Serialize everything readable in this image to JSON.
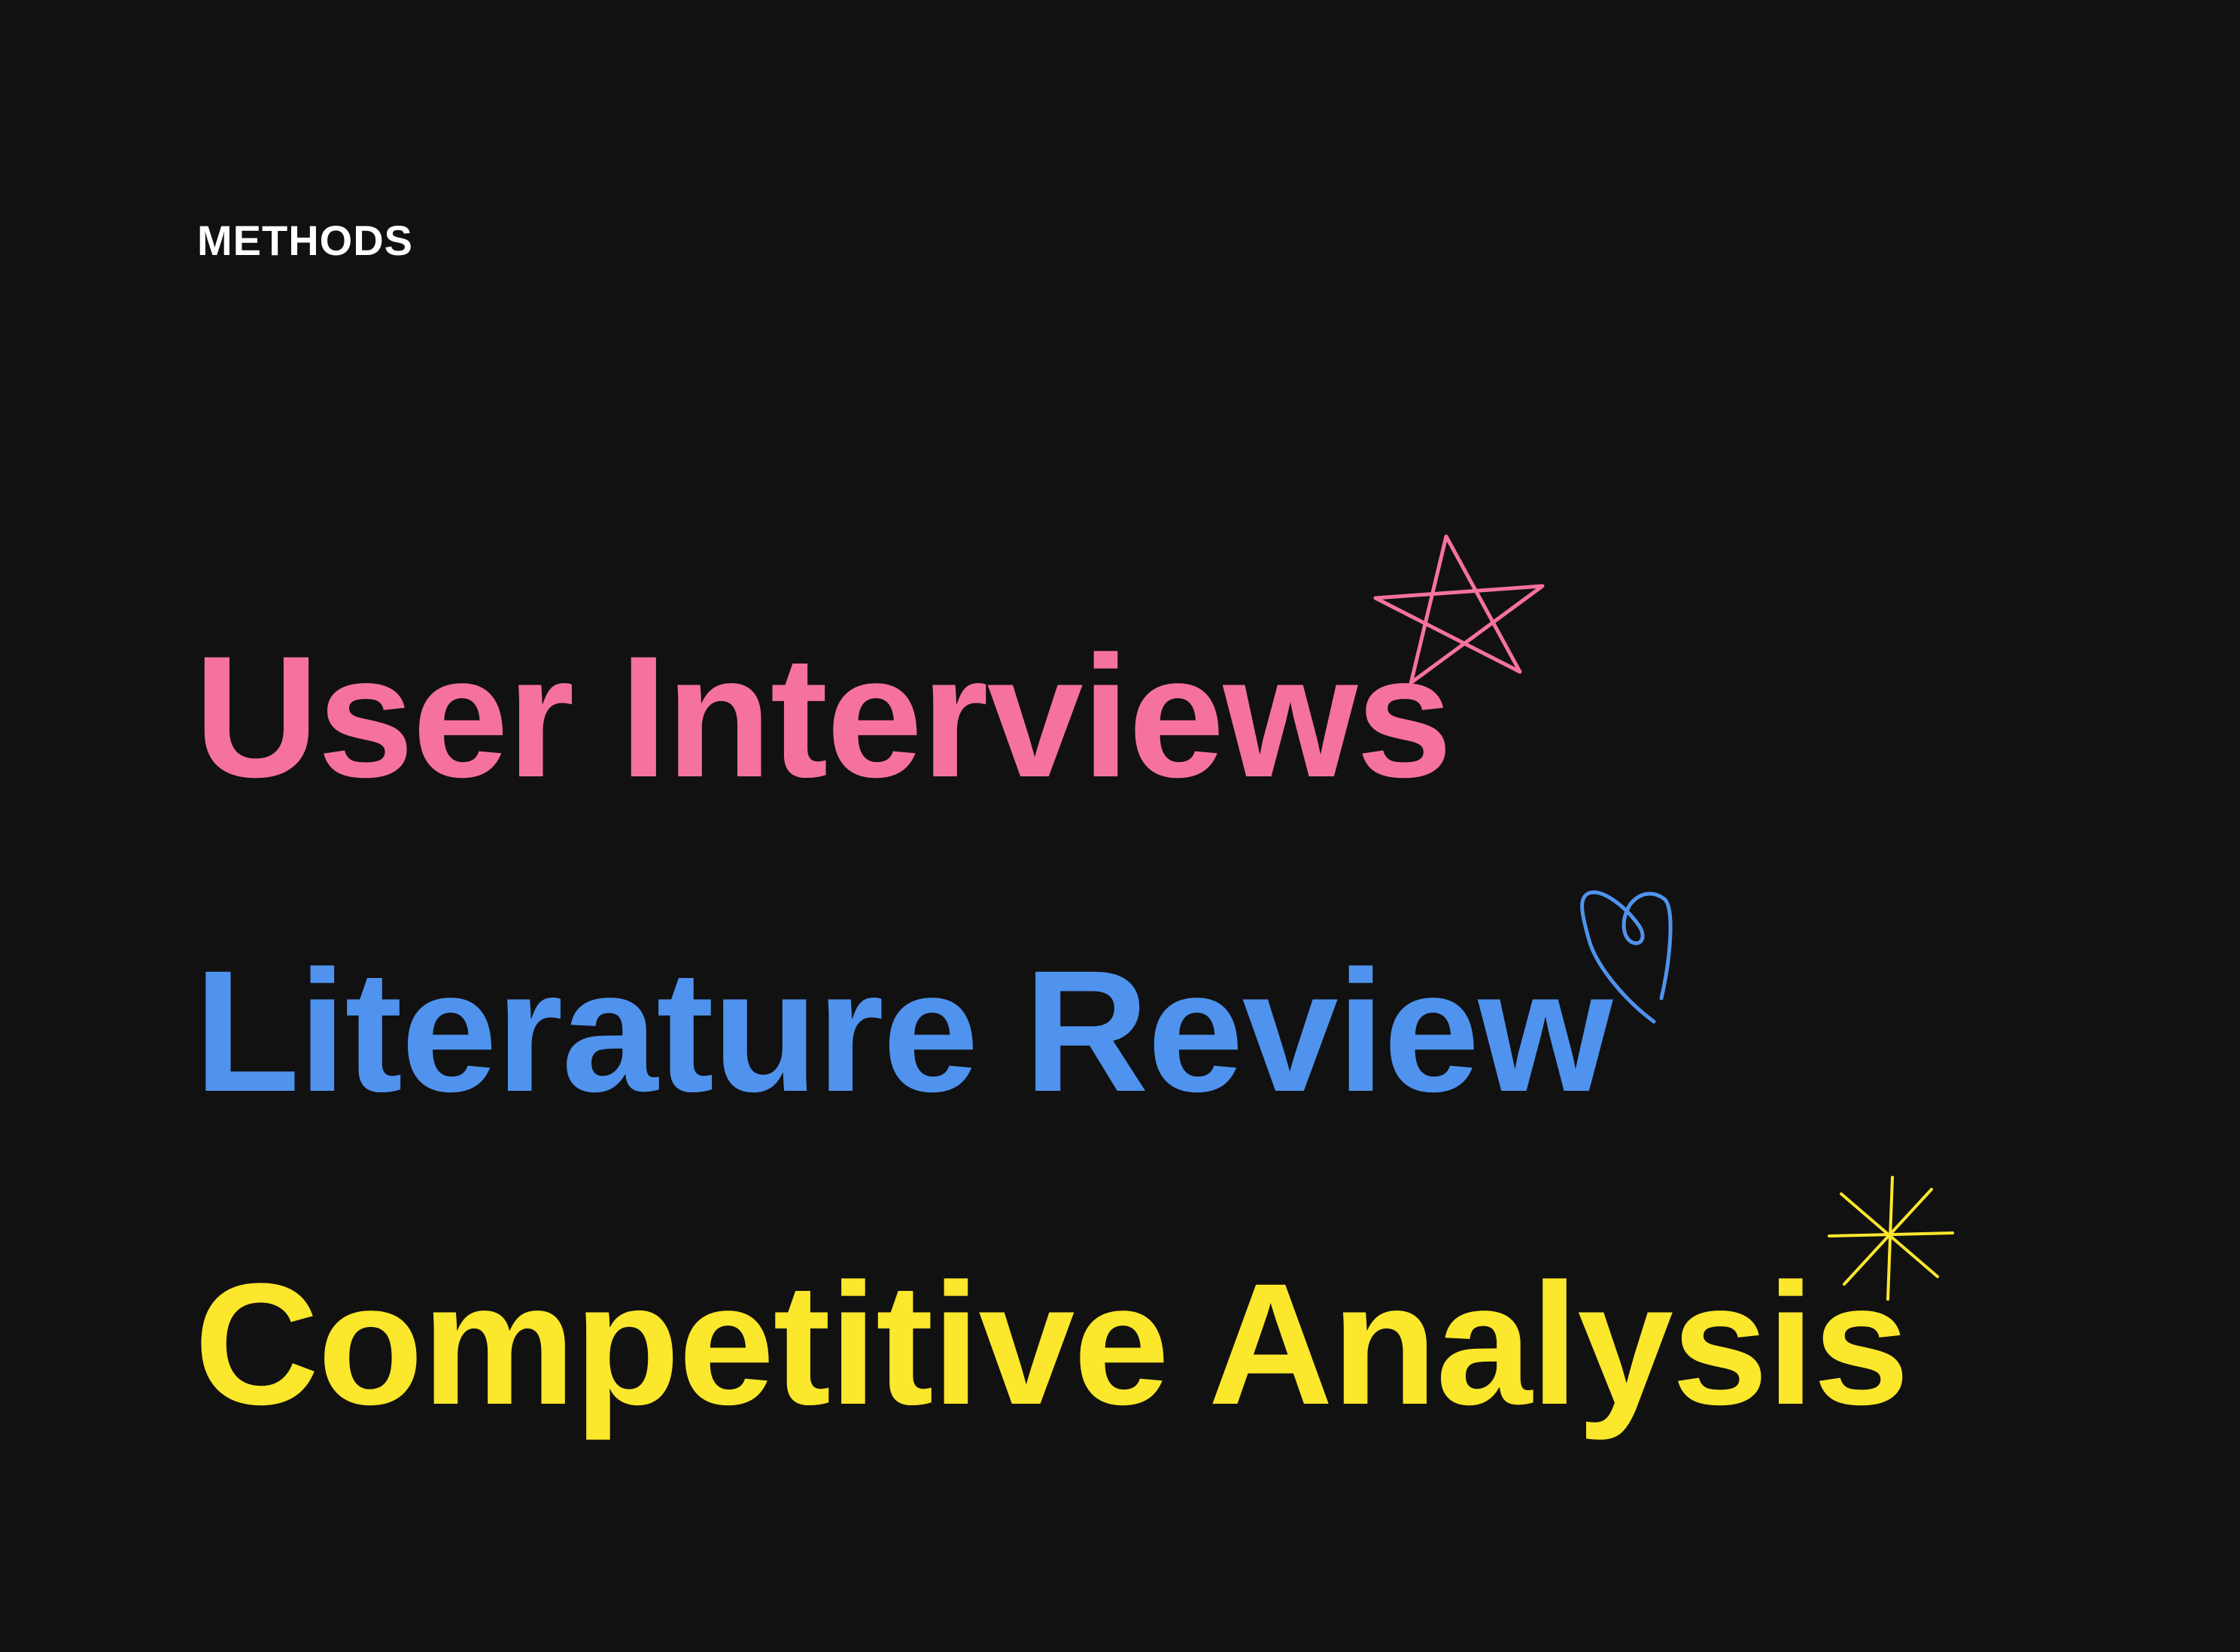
{
  "header": {
    "section_label": "METHODS"
  },
  "methods": [
    {
      "label": "User Interviews",
      "color": "#f6729e",
      "doodle": "star-icon"
    },
    {
      "label": "Literature Review",
      "color": "#4f93ee",
      "doodle": "heart-icon"
    },
    {
      "label": "Competitive Analysis",
      "color": "#fbe72c",
      "doodle": "sparkle-icon"
    }
  ],
  "colors": {
    "background": "#111111",
    "label": "#ffffff"
  }
}
